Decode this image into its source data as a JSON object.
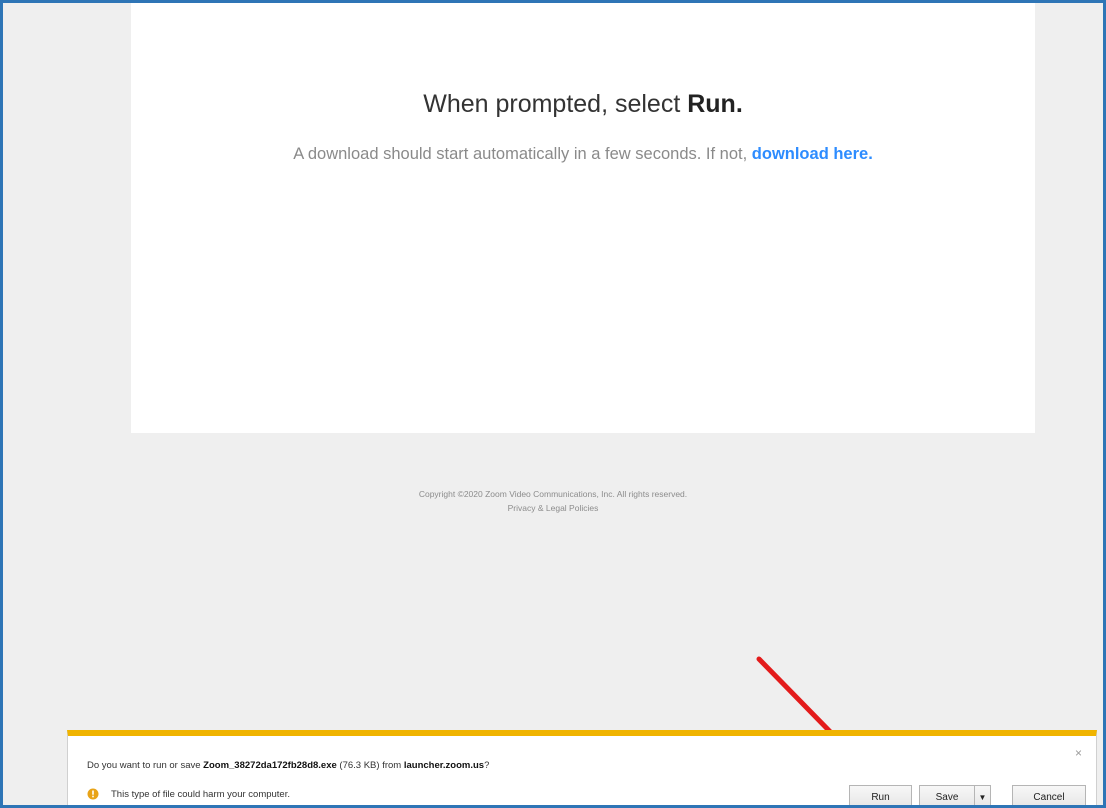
{
  "page": {
    "heading_prefix": "When prompted, select ",
    "heading_emphasis": "Run.",
    "subtext_prefix": "A download should start automatically in a few seconds. If not, ",
    "subtext_link": "download here."
  },
  "footer": {
    "copyright": "Copyright ©2020 Zoom Video Communications, Inc. All rights reserved.",
    "legal_link": "Privacy & Legal Policies"
  },
  "download_bar": {
    "question_prefix": "Do you want to run or save ",
    "file_name": "Zoom_38272da172fb28d8.exe",
    "file_size": " (76.3 KB) from ",
    "source": "launcher.zoom.us",
    "question_suffix": "?",
    "warning": "This type of file could harm your computer.",
    "close_glyph": "×",
    "run_label": "Run",
    "save_label": "Save",
    "save_dropdown_glyph": "▼",
    "cancel_label": "Cancel"
  },
  "colors": {
    "frame_border": "#2e75b6",
    "link": "#2d8cff",
    "download_bar_accent": "#f0b400",
    "arrow": "#e31b1b"
  },
  "icons": {
    "warning": "shield-warning-icon",
    "annotation": "red-arrow-icon"
  }
}
